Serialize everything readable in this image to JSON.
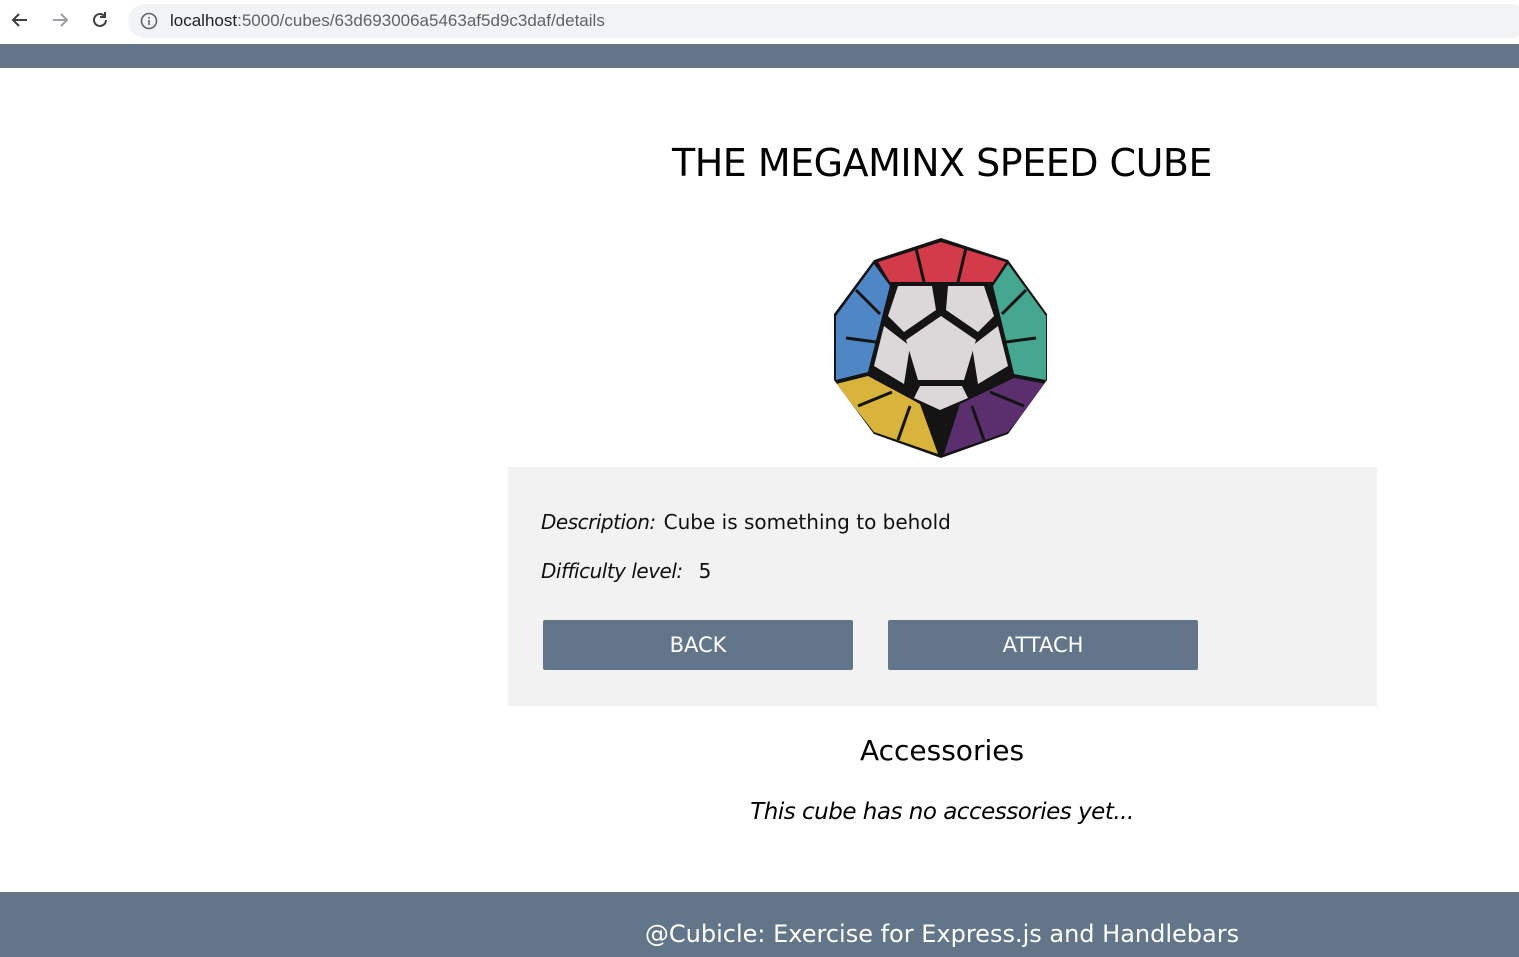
{
  "browser": {
    "url_host": "localhost",
    "url_path": ":5000/cubes/63d693006a5463af5d9c3daf/details"
  },
  "cube": {
    "title": "THE MEGAMINX SPEED CUBE",
    "image_alt": "megaminx-cube-image",
    "description_label": "Description:",
    "description": "Cube is something to behold",
    "difficulty_label": "Difficulty level:",
    "difficulty": "5"
  },
  "actions": {
    "back_label": "BACK",
    "attach_label": "ATTACH"
  },
  "accessories": {
    "title": "Accessories",
    "empty_message": "This cube has no accessories yet..."
  },
  "footer": {
    "text": "@Cubicle: Exercise for Express.js and Handlebars"
  },
  "colors": {
    "brand": "#627589",
    "panel": "#f3f2f2"
  }
}
